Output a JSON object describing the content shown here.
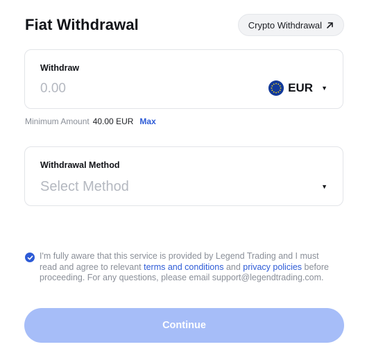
{
  "header": {
    "title": "Fiat Withdrawal",
    "crypto_button_label": "Crypto Withdrawal",
    "crypto_button_icon": "arrow-up-right-icon"
  },
  "withdraw": {
    "label": "Withdraw",
    "amount_placeholder": "0.00",
    "amount_value": "",
    "currency": "EUR",
    "currency_icon": "eu-flag-icon"
  },
  "minimum": {
    "label": "Minimum Amount",
    "value": "40.00 EUR",
    "max_label": "Max"
  },
  "method": {
    "label": "Withdrawal Method",
    "placeholder": "Select Method"
  },
  "terms": {
    "checked": true,
    "text_1": "I'm fully aware that this service is provided by Legend Trading and I must read and agree to relevant",
    "link_terms": "terms and conditions",
    "text_and": "and",
    "link_privacy": "privacy policies",
    "text_2": "before proceeding. For any questions, please email support@legendtrading.com."
  },
  "continue_label": "Continue",
  "colors": {
    "accent": "#2d5bd6",
    "button_disabled": "#a6bdf8",
    "muted_text": "#8a8f98",
    "border": "#e2e4e8"
  }
}
